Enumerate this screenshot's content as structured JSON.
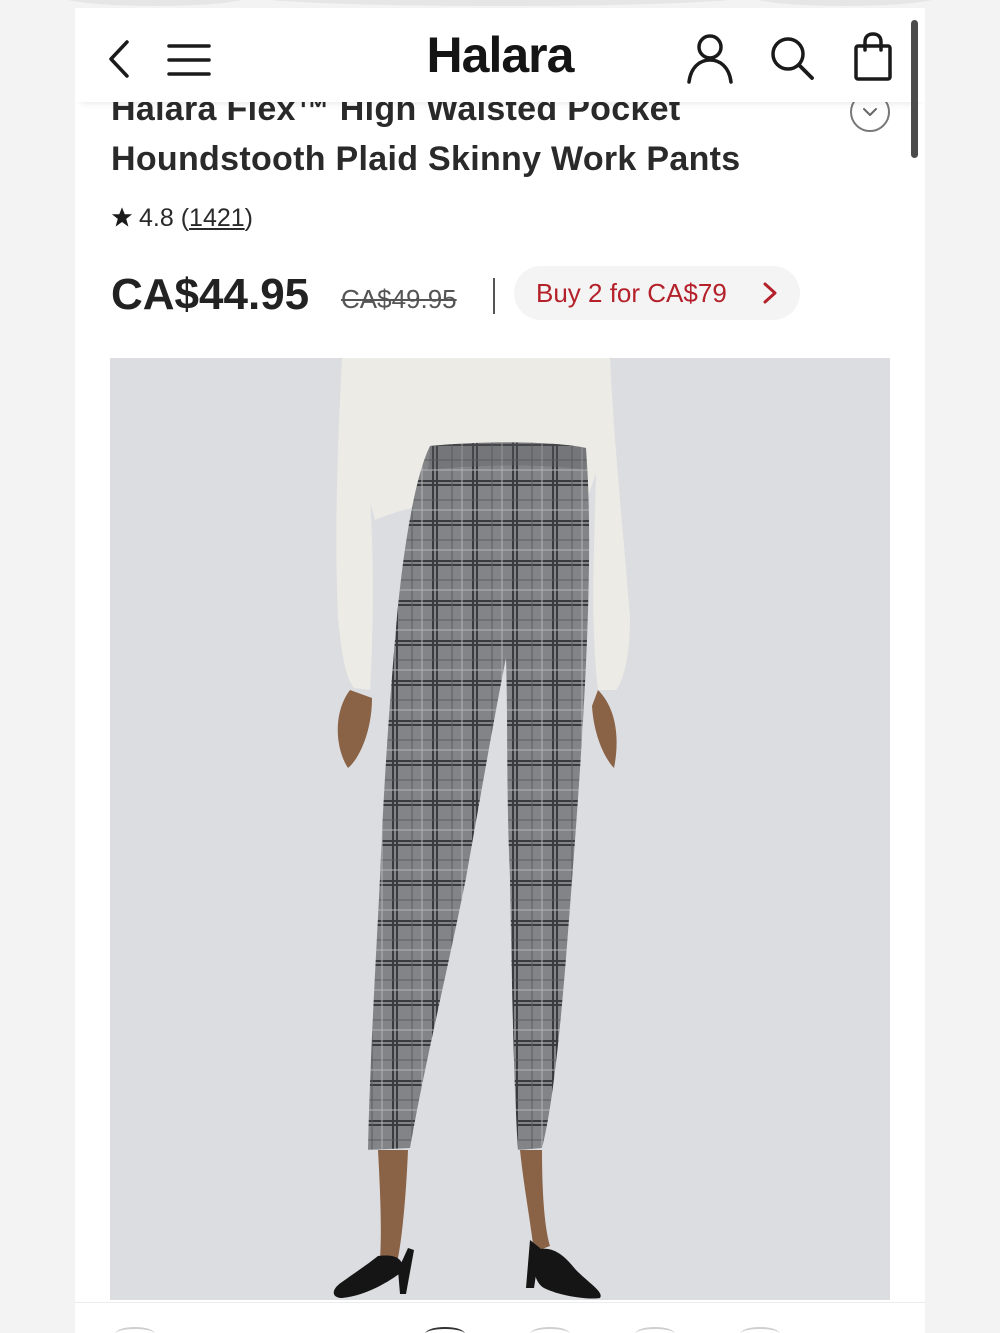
{
  "header": {
    "logo": "Halara",
    "icons": [
      "back-icon",
      "menu-icon",
      "account-icon",
      "search-icon",
      "bag-icon"
    ]
  },
  "product": {
    "title_line1": "Halara Flex™ High Waisted Pocket",
    "title_line2": "Houndstooth Plaid Skinny Work Pants",
    "rating": "4.8",
    "review_count": "1421",
    "price": "CA$44.95",
    "original_price": "CA$49.95",
    "promo": "Buy 2 for CA$79"
  },
  "colors": {
    "promo_text": "#b4212b",
    "text": "#222222",
    "image_background": "#dcdde1"
  }
}
